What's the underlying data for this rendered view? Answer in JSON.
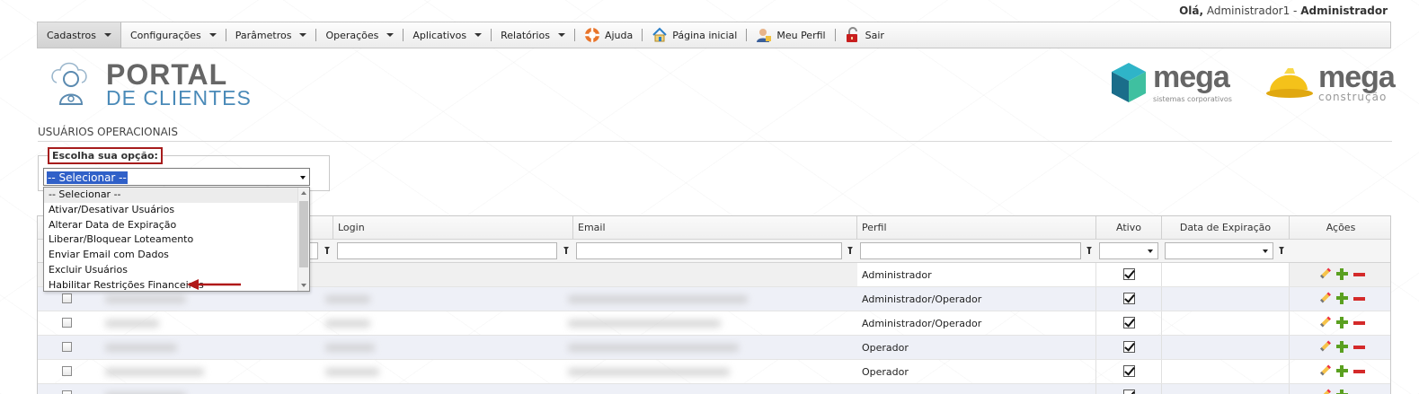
{
  "header": {
    "greeting_prefix": "Olá,",
    "user_name": "Administrador1 -",
    "user_role": "Administrador"
  },
  "menu": [
    {
      "label": "Cadastros",
      "dropdown": true
    },
    {
      "label": "Configurações",
      "dropdown": true
    },
    {
      "label": "Parâmetros",
      "dropdown": true
    },
    {
      "label": "Operações",
      "dropdown": true
    },
    {
      "label": "Aplicativos",
      "dropdown": true
    },
    {
      "label": "Relatórios",
      "dropdown": true
    },
    {
      "label": "Ajuda",
      "icon": "lifebuoy-icon"
    },
    {
      "label": "Página inicial",
      "icon": "home-icon"
    },
    {
      "label": "Meu Perfil",
      "icon": "user-profile-icon"
    },
    {
      "label": "Sair",
      "icon": "exit-icon"
    }
  ],
  "branding": {
    "portal_line1": "PORTAL",
    "portal_line2": "DE CLIENTES",
    "mega1_name": "mega",
    "mega1_sub": "sistemas corporativos",
    "mega2_name": "mega",
    "mega2_sub": "construção"
  },
  "page": {
    "title": "USUÁRIOS OPERACIONAIS",
    "option_legend": "Escolha sua opção:",
    "select_value": "-- Selecionar --",
    "options": [
      "-- Selecionar --",
      "Ativar/Desativar Usuários",
      "Alterar Data de Expiração",
      "Liberar/Bloquear Loteamento",
      "Enviar Email com Dados",
      "Excluir Usuários",
      "Habilitar Restrições Financeiras"
    ]
  },
  "grid": {
    "columns": {
      "login": "Login",
      "email": "Email",
      "perfil": "Perfil",
      "ativo": "Ativo",
      "expiracao": "Data de Expiração",
      "acoes": "Ações"
    },
    "rows": [
      {
        "perfil": "Administrador",
        "ativo": true
      },
      {
        "perfil": "Administrador/Operador",
        "ativo": true
      },
      {
        "perfil": "Administrador/Operador",
        "ativo": true
      },
      {
        "perfil": "Operador",
        "ativo": true
      },
      {
        "perfil": "Operador",
        "ativo": true
      },
      {
        "perfil": "",
        "ativo": true
      }
    ]
  },
  "colors": {
    "accent_red": "#a61c1c",
    "selection_blue": "#3060c8",
    "logo_blue": "#4a8ab8",
    "logo_gray": "#6a6a6a"
  }
}
